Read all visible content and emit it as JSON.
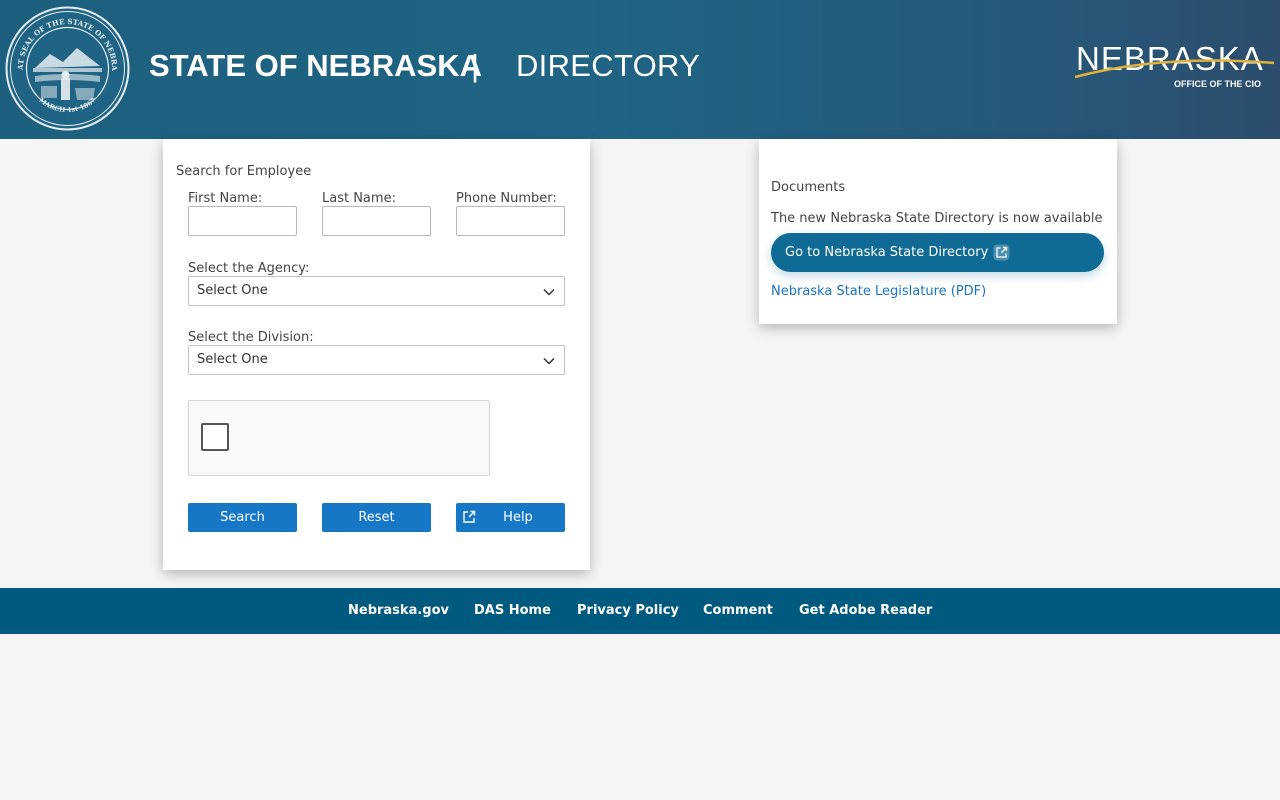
{
  "header": {
    "title_bold": "STATE OF NEBRASKA",
    "separator": "|",
    "title_light": "DIRECTORY",
    "logo_word": "NEBRASKA",
    "logo_sub": "OFFICE OF THE CIO",
    "seal_text": "GREAT SEAL OF THE STATE OF NEBRASKA",
    "seal_date": "MARCH 1st 1867"
  },
  "search": {
    "heading": "Search for Employee",
    "first_name_label": "First Name:",
    "first_name_value": "",
    "last_name_label": "Last Name:",
    "last_name_value": "",
    "phone_label": "Phone Number:",
    "phone_value": "",
    "agency_label": "Select the Agency:",
    "agency_selected": "Select One",
    "division_label": "Select the Division:",
    "division_selected": "Select One",
    "search_button": "Search",
    "reset_button": "Reset",
    "help_button": "Help"
  },
  "documents": {
    "heading": "Documents",
    "notice": "The new Nebraska State Directory is now available",
    "go_button": "Go to Nebraska State Directory",
    "legislature_link": "Nebraska State Legislature (PDF)"
  },
  "footer": {
    "links": [
      "Nebraska.gov",
      "DAS Home",
      "Privacy Policy",
      "Comment",
      "Get Adobe Reader"
    ]
  },
  "colors": {
    "header_bg": "#1f6484",
    "button_blue": "#1677c7",
    "go_button": "#0f6b96",
    "footer_bg": "#005a80",
    "link": "#1a73c4",
    "logo_swoosh": "#e0b23a"
  },
  "icons": {
    "seal": "state-seal-icon",
    "chevron": "chevron-down-icon",
    "external": "external-link-icon",
    "captcha": "checkbox-icon"
  }
}
